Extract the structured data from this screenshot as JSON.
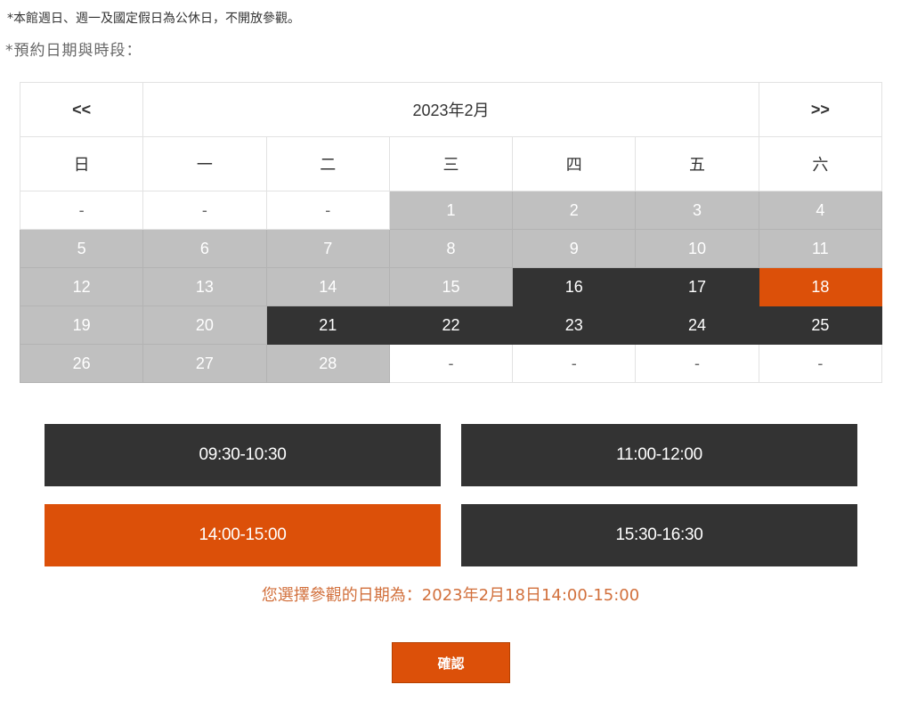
{
  "notice": "*本館週日、週一及國定假日為公休日，不開放參觀。",
  "prompt": "*預約日期與時段：",
  "calendar": {
    "prev_label": "<<",
    "next_label": ">>",
    "month_title": "2023年2月",
    "weekdays": [
      "日",
      "一",
      "二",
      "三",
      "四",
      "五",
      "六"
    ],
    "weeks": [
      [
        {
          "label": "-",
          "state": "empty"
        },
        {
          "label": "-",
          "state": "empty"
        },
        {
          "label": "-",
          "state": "empty"
        },
        {
          "label": "1",
          "state": "disabled"
        },
        {
          "label": "2",
          "state": "disabled"
        },
        {
          "label": "3",
          "state": "disabled"
        },
        {
          "label": "4",
          "state": "disabled"
        }
      ],
      [
        {
          "label": "5",
          "state": "disabled"
        },
        {
          "label": "6",
          "state": "disabled"
        },
        {
          "label": "7",
          "state": "disabled"
        },
        {
          "label": "8",
          "state": "disabled"
        },
        {
          "label": "9",
          "state": "disabled"
        },
        {
          "label": "10",
          "state": "disabled"
        },
        {
          "label": "11",
          "state": "disabled"
        }
      ],
      [
        {
          "label": "12",
          "state": "disabled"
        },
        {
          "label": "13",
          "state": "disabled"
        },
        {
          "label": "14",
          "state": "disabled"
        },
        {
          "label": "15",
          "state": "disabled"
        },
        {
          "label": "16",
          "state": "available"
        },
        {
          "label": "17",
          "state": "available"
        },
        {
          "label": "18",
          "state": "selected"
        }
      ],
      [
        {
          "label": "19",
          "state": "disabled"
        },
        {
          "label": "20",
          "state": "disabled"
        },
        {
          "label": "21",
          "state": "available"
        },
        {
          "label": "22",
          "state": "available"
        },
        {
          "label": "23",
          "state": "available"
        },
        {
          "label": "24",
          "state": "available"
        },
        {
          "label": "25",
          "state": "available"
        }
      ],
      [
        {
          "label": "26",
          "state": "disabled"
        },
        {
          "label": "27",
          "state": "disabled"
        },
        {
          "label": "28",
          "state": "disabled"
        },
        {
          "label": "-",
          "state": "empty"
        },
        {
          "label": "-",
          "state": "empty"
        },
        {
          "label": "-",
          "state": "empty"
        },
        {
          "label": "-",
          "state": "empty"
        }
      ]
    ]
  },
  "time_slots": [
    {
      "label": "09:30-10:30",
      "state": "available"
    },
    {
      "label": "11:00-12:00",
      "state": "available"
    },
    {
      "label": "14:00-15:00",
      "state": "selected"
    },
    {
      "label": "15:30-16:30",
      "state": "available"
    }
  ],
  "summary": "您選擇參觀的日期為：2023年2月18日14:00-15:00",
  "confirm_label": "確認",
  "colors": {
    "available": "#333333",
    "disabled": "#c0c0c0",
    "selected": "#dc5009",
    "summary_text": "#d2703c"
  }
}
